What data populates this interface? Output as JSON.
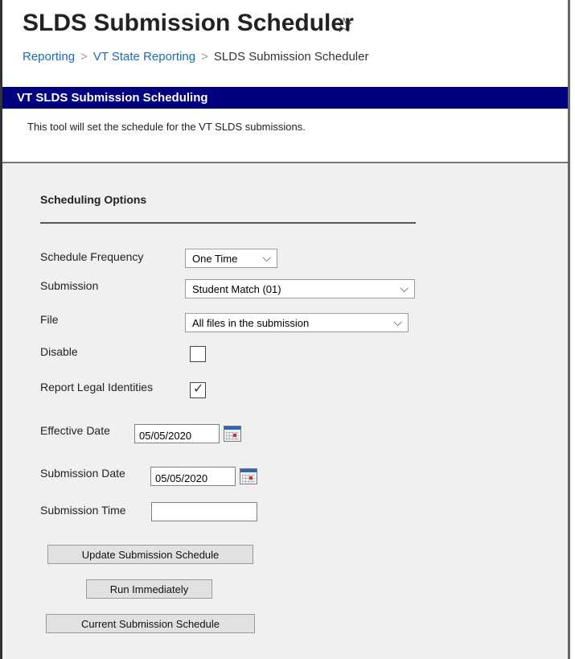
{
  "header": {
    "title": "SLDS Submission Scheduler",
    "star_glyph": "☆",
    "breadcrumb": [
      "Reporting",
      "VT State Reporting",
      "SLDS Submission Scheduler"
    ],
    "breadcrumb_sep": ">"
  },
  "section": {
    "title": "VT SLDS Submission Scheduling",
    "description": "This tool will set the schedule for the VT SLDS submissions.",
    "bar_color": "#00007f"
  },
  "options": {
    "heading": "Scheduling Options",
    "frequency_label": "Schedule Frequency",
    "frequency_value": "One Time",
    "submission_label": "Submission",
    "submission_value": "Student Match (01)",
    "file_label": "File",
    "file_value": "All files in the submission",
    "disable_label": "Disable",
    "disable_checked": false,
    "legal_label": "Report Legal Identities",
    "legal_checked": true,
    "legal_tick": "✓",
    "effective_label": "Effective Date",
    "effective_value": "05/05/2020",
    "submission_date_label": "Submission Date",
    "submission_date_value": "05/05/2020",
    "submission_time_label": "Submission Time",
    "submission_time_value": "",
    "chevron_glyph": "⌵"
  },
  "buttons": {
    "update": "Update Submission Schedule",
    "run": "Run Immediately",
    "current": "Current Submission Schedule"
  }
}
